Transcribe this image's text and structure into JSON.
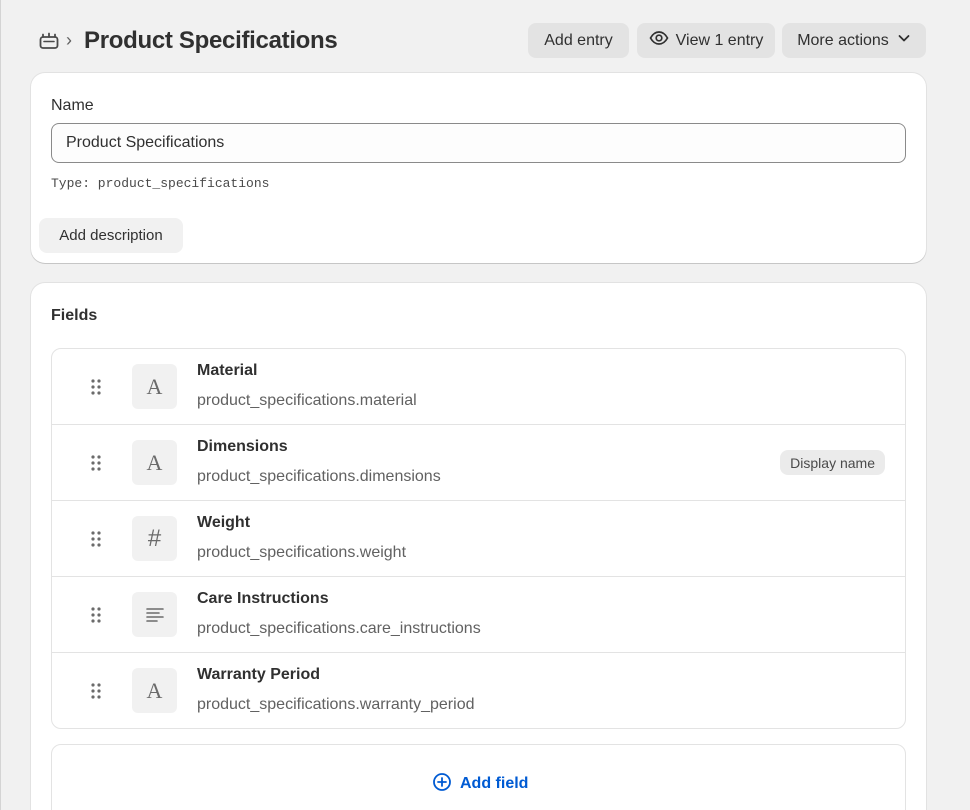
{
  "header": {
    "icon": "metaobject-icon",
    "title": "Product Specifications",
    "buttons": {
      "add_entry": "Add entry",
      "view_entry": "View 1 entry",
      "more_actions": "More actions"
    }
  },
  "name_card": {
    "label": "Name",
    "value": "Product Specifications",
    "type_line": "Type: product_specifications",
    "add_description": "Add description"
  },
  "fields_card": {
    "title": "Fields",
    "fields": [
      {
        "name": "Material",
        "key": "product_specifications.material",
        "type_icon": "text-icon",
        "badge": ""
      },
      {
        "name": "Dimensions",
        "key": "product_specifications.dimensions",
        "type_icon": "text-icon",
        "badge": "Display name"
      },
      {
        "name": "Weight",
        "key": "product_specifications.weight",
        "type_icon": "number-icon",
        "badge": ""
      },
      {
        "name": "Care Instructions",
        "key": "product_specifications.care_instructions",
        "type_icon": "multiline-text-icon",
        "badge": ""
      },
      {
        "name": "Warranty Period",
        "key": "product_specifications.warranty_period",
        "type_icon": "text-icon",
        "badge": ""
      }
    ],
    "add_field": "Add field"
  },
  "colors": {
    "accent": "#005bd3",
    "background": "#f1f1f1",
    "button": "#e3e3e3"
  }
}
